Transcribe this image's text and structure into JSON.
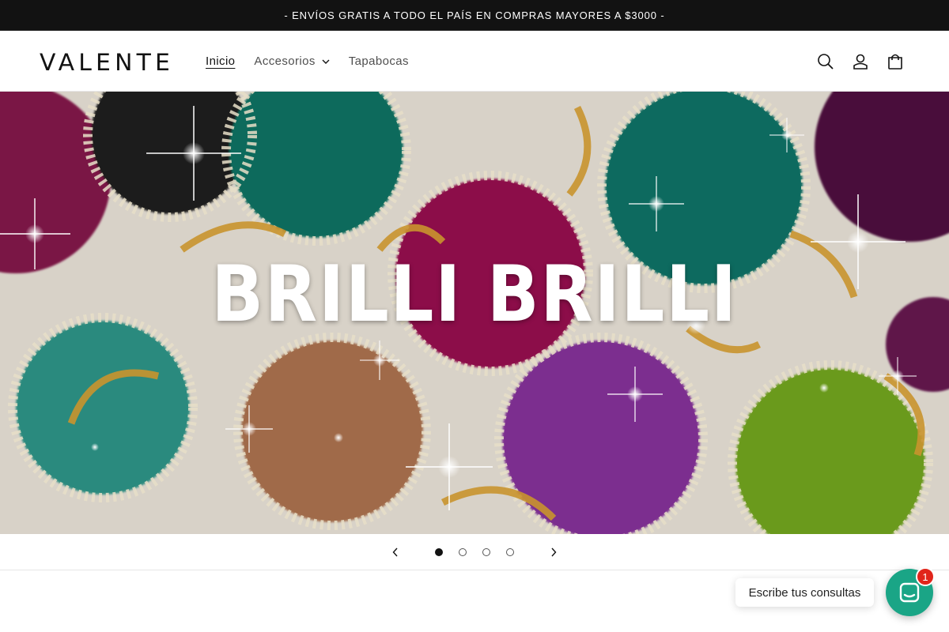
{
  "announcement": {
    "text": "- ENVÍOS GRATIS A TODO EL PAÍS EN COMPRAS MAYORES A $3000 -"
  },
  "header": {
    "logo_text": "VALENTE",
    "nav": [
      {
        "label": "Inicio",
        "active": true
      },
      {
        "label": "Accesorios",
        "has_dropdown": true
      },
      {
        "label": "Tapabocas"
      }
    ],
    "icons": [
      "search-icon",
      "account-icon",
      "cart-icon"
    ]
  },
  "hero": {
    "title": "BRILLI BRILLI"
  },
  "slider": {
    "slide_count": 4,
    "active_index": 0
  },
  "chat": {
    "prompt": "Escribe tus consultas",
    "badge_count": "1"
  },
  "colors": {
    "chat_accent": "#1aa586",
    "badge": "#e1251b",
    "announcement_bg": "#121212"
  }
}
